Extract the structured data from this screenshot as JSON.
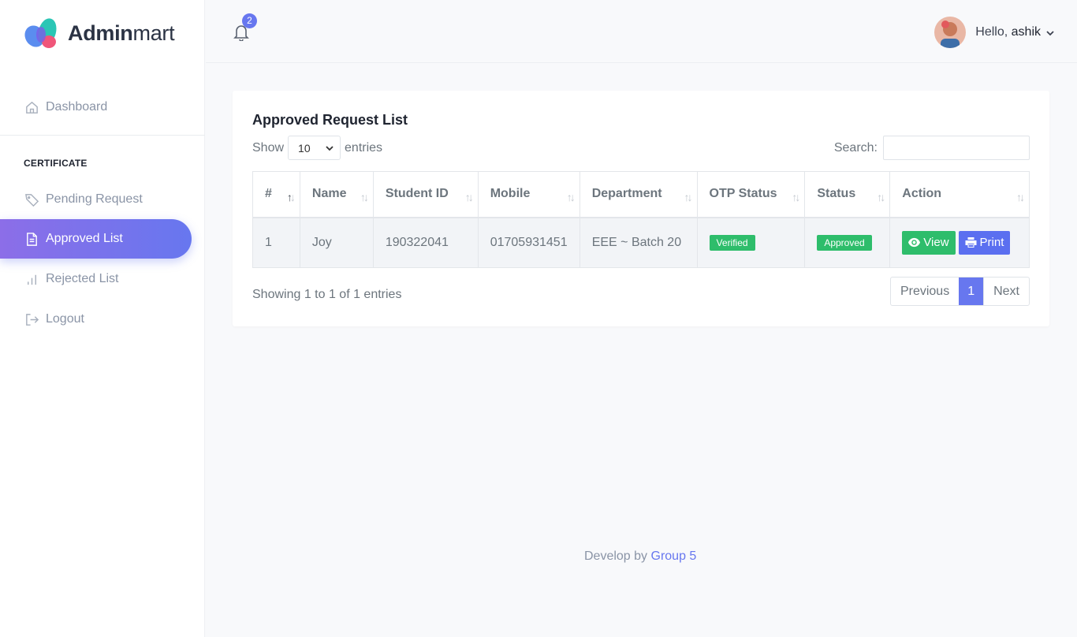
{
  "brand": {
    "bold": "Admin",
    "light": "mart"
  },
  "sidebar": {
    "dashboard": {
      "label": "Dashboard",
      "icon": "home-icon"
    },
    "section_caption": "CERTIFICATE",
    "items": [
      {
        "label": "Pending Request",
        "icon": "tag-icon"
      },
      {
        "label": "Approved List",
        "icon": "document-icon",
        "active": true
      },
      {
        "label": "Rejected List",
        "icon": "bar-chart-icon"
      },
      {
        "label": "Logout",
        "icon": "logout-icon"
      }
    ]
  },
  "topbar": {
    "notification_count": "2",
    "greeting": "Hello,",
    "username": "ashik"
  },
  "card": {
    "title": "Approved Request List",
    "show_label": "Show",
    "entries_value": "10",
    "entries_label": "entries",
    "search_label": "Search:",
    "search_value": ""
  },
  "table": {
    "headers": [
      "#",
      "Name",
      "Student ID",
      "Mobile",
      "Department",
      "OTP Status",
      "Status",
      "Action"
    ],
    "rows": [
      {
        "index": "1",
        "name": "Joy",
        "student_id": "190322041",
        "mobile": "01705931451",
        "department": "EEE ~ Batch 20",
        "otp_status": "Verified",
        "status": "Approved",
        "view_label": "View",
        "print_label": "Print"
      }
    ]
  },
  "pagination": {
    "info": "Showing 1 to 1 of 1 entries",
    "previous": "Previous",
    "current": "1",
    "next": "Next"
  },
  "footer": {
    "text": "Develop by",
    "link": "Group 5"
  },
  "colors": {
    "accent": "#6777ef",
    "success": "#2ebd6b",
    "gradient_start": "#8c6ee8"
  }
}
